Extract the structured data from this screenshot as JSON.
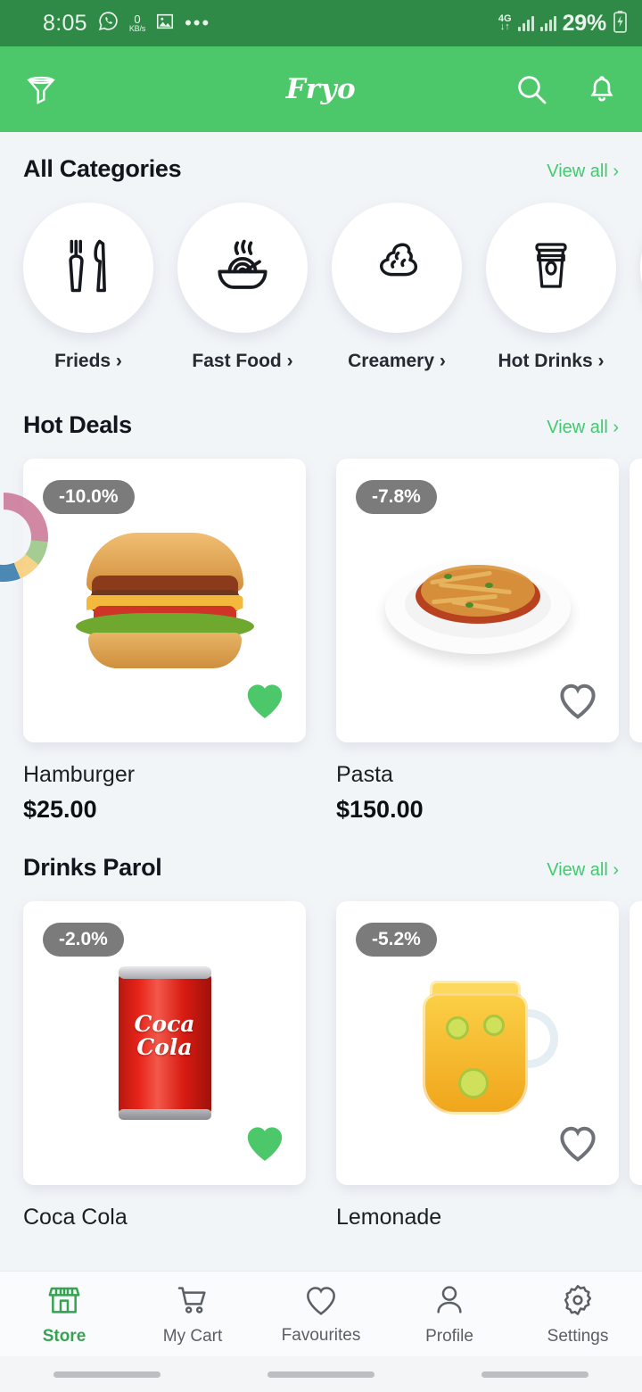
{
  "status_bar": {
    "time": "8:05",
    "whatsapp_icon": "whatsapp-icon",
    "data_speed_value": "0",
    "data_speed_unit": "KB/s",
    "gallery_icon": "image-icon",
    "more_icon": "more-dots-icon",
    "network_type": "4G",
    "network_arrows": "↓↑",
    "battery_percent": "29%",
    "battery_icon": "battery-charging-icon",
    "bg_color": "#2F8A47"
  },
  "app_bar": {
    "filter_icon": "filter-funnel-icon",
    "title": "Fryo",
    "search_icon": "search-icon",
    "notification_icon": "bell-icon",
    "bg_color": "#4CC76A"
  },
  "categories_section": {
    "title": "All Categories",
    "view_all_label": "View all ›",
    "items": [
      {
        "label": "Frieds ›",
        "icon": "fork-knife-icon"
      },
      {
        "label": "Fast Food ›",
        "icon": "noodle-bowl-icon"
      },
      {
        "label": "Creamery ›",
        "icon": "ice-cream-swirl-icon"
      },
      {
        "label": "Hot Drinks ›",
        "icon": "coffee-cup-icon"
      }
    ]
  },
  "hot_deals_section": {
    "title": "Hot Deals",
    "view_all_label": "View all ›",
    "products": [
      {
        "name": "Hamburger",
        "price": "$25.00",
        "discount": "-10.0%",
        "favourite": true,
        "image": "hamburger-photo"
      },
      {
        "name": "Pasta",
        "price": "$150.00",
        "discount": "-7.8%",
        "favourite": false,
        "image": "pasta-plate-photo"
      }
    ]
  },
  "drinks_section": {
    "title": "Drinks Parol",
    "view_all_label": "View all ›",
    "products": [
      {
        "name": "Coca Cola",
        "price": "",
        "discount": "-2.0%",
        "favourite": true,
        "image": "coca-cola-can-photo",
        "can_text_line1": "Coca",
        "can_text_line2": "Cola"
      },
      {
        "name": "Lemonade",
        "price": "",
        "discount": "-5.2%",
        "favourite": false,
        "image": "juice-pitcher-photo"
      }
    ]
  },
  "floating_widget": {
    "name": "donut-chart-overlay",
    "colors": [
      "#CE7E9B",
      "#9DC88A",
      "#F7D080",
      "#3D7FAE",
      "#79C4E8"
    ]
  },
  "bottom_nav": {
    "active": "Store",
    "items": [
      {
        "label": "Store",
        "icon": "store-icon"
      },
      {
        "label": "My Cart",
        "icon": "shopping-cart-icon"
      },
      {
        "label": "Favourites",
        "icon": "heart-icon"
      },
      {
        "label": "Profile",
        "icon": "person-icon"
      },
      {
        "label": "Settings",
        "icon": "gear-icon"
      }
    ]
  },
  "theme": {
    "accent_green": "#3FCB6E",
    "header_green": "#4CC76A",
    "status_green": "#2F8A47",
    "page_bg": "#F2F5F8",
    "badge_gray": "#7B7B7B",
    "heart_active": "#4CC76A",
    "heart_inactive": "#6E7277"
  }
}
